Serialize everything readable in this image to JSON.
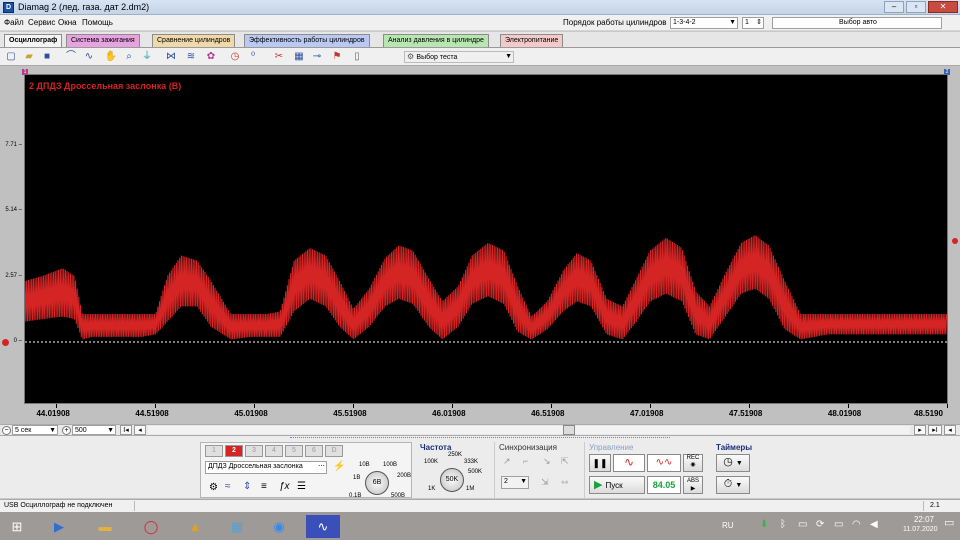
{
  "window": {
    "title": "Diamag 2 (лед. газа. дат 2.dm2)",
    "app_icon": "D"
  },
  "menu": [
    "Файл",
    "Сервис",
    "Окна",
    "Помощь"
  ],
  "header": {
    "cyl_order_label": "Порядок работы цилиндров",
    "cyl_order_value": "1-3-4-2",
    "cyl_num_value": "1",
    "auto_select_label": "Выбор авто"
  },
  "tabs": [
    {
      "label": "Осциллограф",
      "color": "#f4f4f4"
    },
    {
      "label": "Система зажигания",
      "color": "#e6a3df"
    },
    {
      "label": "Сравнение цилиндров",
      "color": "#f0d9a8"
    },
    {
      "label": "Эффективность работы цилиндров",
      "color": "#b9c9f3"
    },
    {
      "label": "Анализ давления в цилиндре",
      "color": "#b7e6b0"
    },
    {
      "label": "Электропитание",
      "color": "#f3c9c9"
    }
  ],
  "toolbar": {
    "test_select_label": "Выбор теста",
    "icons": [
      "new-file-icon",
      "open-folder-icon",
      "save-icon",
      "cursor-icon",
      "waveform-up-icon",
      "waveform-down-icon",
      "hand-icon",
      "zoom-icon",
      "filter-icon",
      "compress-icon",
      "expand-icon",
      "cursor-marker-icon",
      "stopwatch-icon",
      "counter-icon",
      "trim-icon",
      "grid-icon",
      "split-icon",
      "flag-icon",
      "page-icon"
    ]
  },
  "oscillogram": {
    "channel_label": "2 ДПДЗ Дроссельная заслонка (В)",
    "marker_left": "1",
    "marker_right": "2",
    "trace_color": "#d42424"
  },
  "chart_data": {
    "type": "line",
    "title": "2 ДПДЗ Дроссельная заслонка (В)",
    "xlabel": "",
    "ylabel": "",
    "x_ticks": [
      "44.01908",
      "44.51908",
      "45.01908",
      "45.51908",
      "46.01908",
      "46.51908",
      "47.01908",
      "47.51908",
      "48.01908",
      "48.5190"
    ],
    "y_ticks": [
      "7.71",
      "5.14",
      "2.57",
      "0"
    ],
    "xlim": [
      43.86,
      48.52
    ],
    "ylim": [
      -2.4,
      10.5
    ],
    "series": [
      {
        "envelope_x": [
          43.86,
          43.95,
          44.05,
          44.11,
          44.15,
          44.2,
          44.3,
          44.38,
          44.45,
          44.52,
          44.58,
          44.65,
          44.73,
          44.8,
          44.9,
          45.0,
          45.08,
          45.15,
          45.22,
          45.3,
          45.38,
          45.45,
          45.52,
          45.6,
          45.68,
          45.75,
          45.82,
          45.9,
          45.97,
          46.05,
          46.12,
          46.2,
          46.28,
          46.35,
          46.42,
          46.5,
          46.58,
          46.65,
          46.72,
          46.8,
          46.88,
          46.95,
          47.02,
          47.1,
          47.18,
          47.25,
          47.32,
          47.4,
          47.48,
          47.55,
          47.62,
          47.7,
          47.78,
          47.85,
          47.92,
          48.0,
          48.1,
          48.2,
          48.3,
          48.4,
          48.52
        ],
        "upper": [
          2.4,
          2.6,
          2.9,
          2.6,
          1.1,
          1.1,
          1.1,
          1.1,
          1.1,
          1.1,
          2.6,
          3.4,
          3.2,
          2.4,
          1.1,
          1.1,
          1.1,
          1.2,
          3.2,
          3.7,
          3.4,
          2.4,
          1.3,
          2.1,
          3.3,
          3.8,
          3.6,
          2.5,
          1.6,
          2.2,
          3.4,
          3.9,
          3.6,
          2.2,
          1.0,
          1.6,
          2.8,
          3.5,
          3.2,
          1.7,
          1.4,
          2.5,
          3.6,
          4.1,
          3.7,
          2.0,
          1.4,
          2.7,
          3.9,
          4.2,
          3.8,
          2.4,
          1.1,
          1.1,
          1.1,
          1.1,
          1.1,
          1.1,
          1.1,
          1.1,
          1.1
        ],
        "lower": [
          0.8,
          0.9,
          1.0,
          0.9,
          0.1,
          0.2,
          0.2,
          0.2,
          0.2,
          0.3,
          0.8,
          1.4,
          1.4,
          0.6,
          0.1,
          0.2,
          0.2,
          0.2,
          1.2,
          1.7,
          1.4,
          0.6,
          0.1,
          0.6,
          1.4,
          1.7,
          1.5,
          0.6,
          0.1,
          0.6,
          1.5,
          1.8,
          1.5,
          0.4,
          0.1,
          0.5,
          1.2,
          1.6,
          1.4,
          0.3,
          0.1,
          0.8,
          1.6,
          1.9,
          1.6,
          0.3,
          0.1,
          1.0,
          1.9,
          2.1,
          1.7,
          0.5,
          0.1,
          0.2,
          0.3,
          0.3,
          0.3,
          0.3,
          0.3,
          0.3,
          0.3
        ]
      }
    ],
    "zero_line": 0,
    "grid": false
  },
  "scrollbar": {
    "time_scale": "5 сек",
    "amp_scale": "500"
  },
  "channels": {
    "buttons": [
      "1",
      "2",
      "3",
      "4",
      "5",
      "6",
      "D"
    ],
    "active": "2",
    "channel_select": "ДПДЗ Дроссельная заслонка",
    "volt_labels": [
      "10В",
      "100В",
      "1В",
      "200В",
      "0.1В",
      "500В"
    ],
    "volt_knob": "6В"
  },
  "frequency": {
    "title": "Частота",
    "labels": [
      "250K",
      "100K",
      "333K",
      "500K",
      "1K",
      "1M"
    ],
    "knob": "50K"
  },
  "sync": {
    "title": "Синхронизация",
    "select_value": "2"
  },
  "control": {
    "title": "Управление",
    "start_label": "Пуск",
    "rate_value": "84.05"
  },
  "timers": {
    "title": "Таймеры"
  },
  "status": {
    "left": "USB Осциллограф не подключен",
    "right": "2.1"
  },
  "taskbar": {
    "lang": "RU",
    "time": "22:07",
    "date": "11.07.2020"
  }
}
